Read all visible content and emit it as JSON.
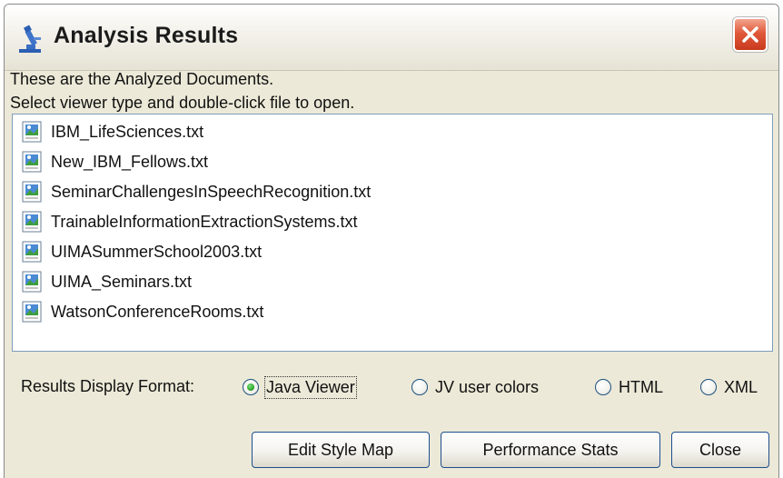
{
  "window": {
    "title": "Analysis Results",
    "title_icon": "microscope-icon",
    "close_icon": "close-icon"
  },
  "description": {
    "line1": "These are the Analyzed Documents.",
    "line2": "Select viewer type and double-click file to open."
  },
  "files": [
    "IBM_LifeSciences.txt",
    "New_IBM_Fellows.txt",
    "SeminarChallengesInSpeechRecognition.txt",
    "TrainableInformationExtractionSystems.txt",
    "UIMASummerSchool2003.txt",
    "UIMA_Seminars.txt",
    "WatsonConferenceRooms.txt"
  ],
  "format": {
    "label": "Results Display Format:",
    "options": [
      {
        "label": "Java Viewer",
        "selected": true
      },
      {
        "label": "JV user colors",
        "selected": false
      },
      {
        "label": "HTML",
        "selected": false
      },
      {
        "label": "XML",
        "selected": false
      }
    ]
  },
  "buttons": {
    "edit_style_map": "Edit Style Map",
    "performance_stats": "Performance Stats",
    "close": "Close"
  },
  "colors": {
    "window_bg": "#ece9d8",
    "close_button": "#e0583a",
    "radio_selected": "#2fa82f",
    "list_border": "#7f9db9"
  }
}
